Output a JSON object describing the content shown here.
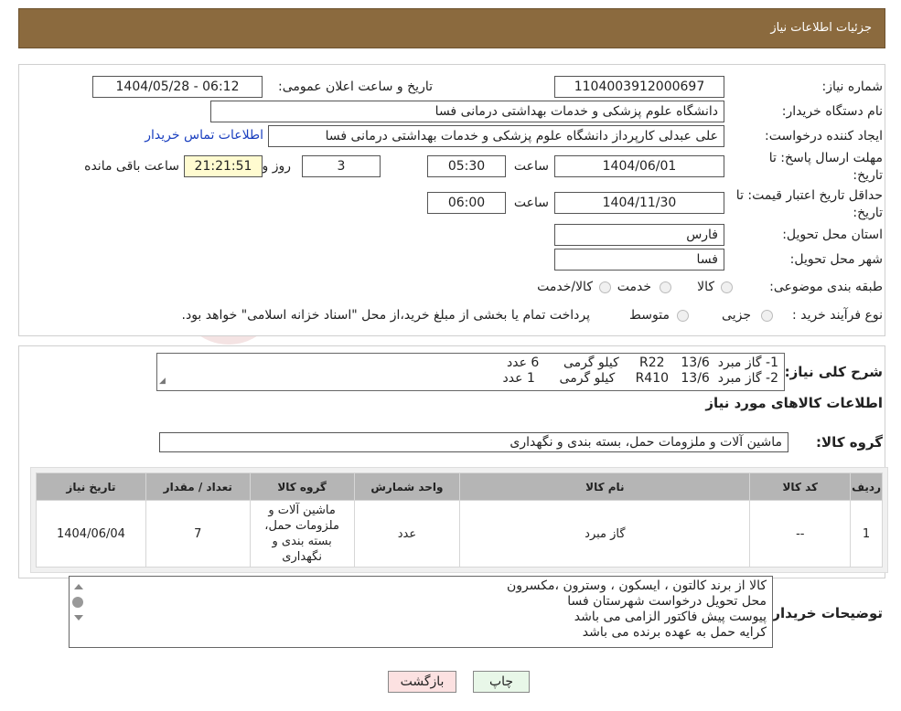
{
  "header": {
    "title": "جزئیات اطلاعات نیاز"
  },
  "watermark": {
    "text": "AriaTender.neT"
  },
  "form": {
    "need_number_label": "شماره نیاز:",
    "need_number": "1104003912000697",
    "announce_label": "تاریخ و ساعت اعلان عمومی:",
    "announce_value": "1404/05/28 - 06:12",
    "buyer_org_label": "نام دستگاه خریدار:",
    "buyer_org": "دانشگاه علوم پزشکی و خدمات بهداشتی درمانی فسا",
    "creator_label": "ایجاد کننده درخواست:",
    "creator": "علی عبدلی کارپرداز دانشگاه علوم پزشکی و خدمات بهداشتی درمانی فسا",
    "contact_link": "اطلاعات تماس خریدار",
    "deadline_label_1": "مهلت ارسال پاسخ: تا",
    "deadline_label_2": "تاریخ:",
    "deadline_date": "1404/06/01",
    "time_label": "ساعت",
    "deadline_time": "05:30",
    "days_value": "3",
    "days_label": "روز و",
    "remaining_time": "21:21:51",
    "remaining_label": "ساعت باقی مانده",
    "validity_label_1": "حداقل تاریخ اعتبار قیمت: تا",
    "validity_label_2": "تاریخ:",
    "validity_date": "1404/11/30",
    "validity_time": "06:00",
    "province_label": "استان محل تحویل:",
    "province": "فارس",
    "city_label": "شهر محل تحویل:",
    "city": "فسا",
    "category_label": "طبقه بندی موضوعی:",
    "category_options": [
      "کالا",
      "خدمت",
      "کالا/خدمت"
    ],
    "process_label": "نوع فرآیند خرید :",
    "process_options": [
      "جزیی",
      "متوسط"
    ],
    "process_note": "پرداخت تمام یا بخشی از مبلغ خرید،از محل \"اسناد خزانه اسلامی\" خواهد بود."
  },
  "summary": {
    "label": "شرح کلی نیاز:",
    "lines": [
      "1- گاز مبرد  13/6    R22     کیلو گرمی      6 عدد",
      "2- گاز مبرد  13/6   R410     کیلو گرمی      1 عدد"
    ]
  },
  "goods": {
    "section_title": "اطلاعات کالاهای مورد نیاز",
    "group_label": "گروه کالا:",
    "group_value": "ماشین آلات و ملزومات حمل، بسته بندی و نگهداری"
  },
  "table": {
    "headers": [
      "ردیف",
      "کد کالا",
      "نام کالا",
      "واحد شمارش",
      "گروه کالا",
      "تعداد / مقدار",
      "تاریخ نیاز"
    ],
    "rows": [
      [
        "1",
        "--",
        "گاز مبرد",
        "عدد",
        "ماشین آلات و ملزومات حمل، بسته بندی و نگهداری",
        "7",
        "1404/06/04"
      ]
    ]
  },
  "buyer_notes": {
    "label": "توضیحات خریدار:",
    "lines": [
      "کالا از برند کالتون ، ایسکون ، وسترون ،مکسرون",
      "محل تحویل درخواست شهرستان فسا",
      "پیوست پیش فاکتور الزامی می باشد",
      "کرایه حمل به عهده برنده می باشد"
    ]
  },
  "buttons": {
    "print": "چاپ",
    "back": "بازگشت"
  }
}
